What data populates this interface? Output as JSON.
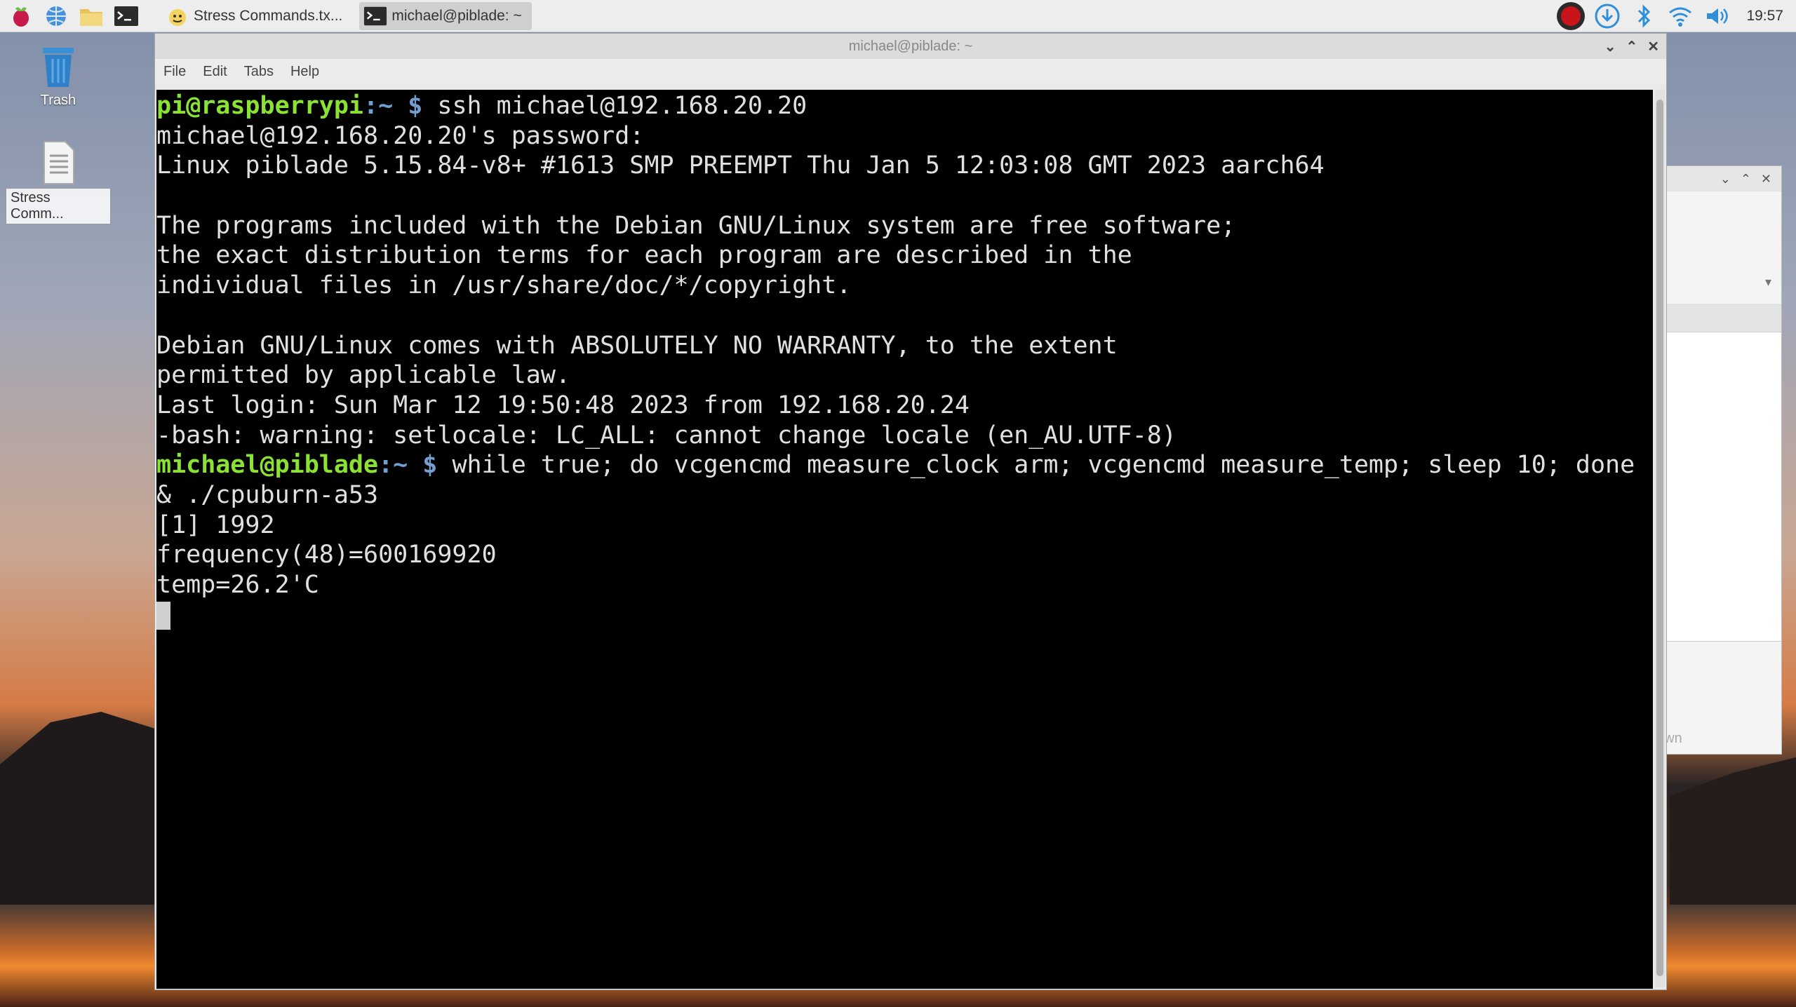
{
  "taskbar": {
    "launchers": [
      {
        "icon": "raspberry-menu-icon"
      },
      {
        "icon": "web-browser-icon"
      },
      {
        "icon": "file-manager-icon"
      },
      {
        "icon": "terminal-icon"
      }
    ],
    "tasks": [
      {
        "label": "Stress Commands.tx...",
        "icon": "text-editor-icon",
        "active": false
      },
      {
        "label": "michael@piblade: ~",
        "icon": "terminal-icon",
        "active": true
      }
    ],
    "tray": [
      "record-icon",
      "download-icon",
      "bluetooth-icon",
      "wifi-icon",
      "volume-icon"
    ],
    "clock": "19:57"
  },
  "desktop": {
    "icons": [
      {
        "label": "Trash",
        "icon": "trash-icon",
        "selected": false
      },
      {
        "label": "Stress Comm...",
        "icon": "text-file-icon",
        "selected": true
      }
    ]
  },
  "background_window": {
    "partial_text": "own"
  },
  "terminal_window": {
    "title": "michael@piblade: ~",
    "controls": [
      "minimize-icon",
      "maximize-icon",
      "close-icon"
    ],
    "menu": [
      "File",
      "Edit",
      "Tabs",
      "Help"
    ],
    "lines": [
      {
        "prompt_user": "pi@raspberrypi",
        "prompt_path": ":~",
        "prompt_sign": " $",
        "text": " ssh michael@192.168.20.20"
      },
      {
        "text": "michael@192.168.20.20's password:"
      },
      {
        "text": "Linux piblade 5.15.84-v8+ #1613 SMP PREEMPT Thu Jan 5 12:03:08 GMT 2023 aarch64"
      },
      {
        "text": ""
      },
      {
        "text": "The programs included with the Debian GNU/Linux system are free software;"
      },
      {
        "text": "the exact distribution terms for each program are described in the"
      },
      {
        "text": "individual files in /usr/share/doc/*/copyright."
      },
      {
        "text": ""
      },
      {
        "text": "Debian GNU/Linux comes with ABSOLUTELY NO WARRANTY, to the extent"
      },
      {
        "text": "permitted by applicable law."
      },
      {
        "text": "Last login: Sun Mar 12 19:50:48 2023 from 192.168.20.24"
      },
      {
        "text": "-bash: warning: setlocale: LC_ALL: cannot change locale (en_AU.UTF-8)"
      },
      {
        "prompt_user": "michael@piblade",
        "prompt_path": ":~",
        "prompt_sign": " $",
        "text": " while true; do vcgencmd measure_clock arm; vcgencmd measure_temp; sleep 10; done"
      },
      {
        "text": "& ./cpuburn-a53"
      },
      {
        "text": "[1] 1992"
      },
      {
        "text": "frequency(48)=600169920"
      },
      {
        "text": "temp=26.2'C"
      }
    ]
  }
}
